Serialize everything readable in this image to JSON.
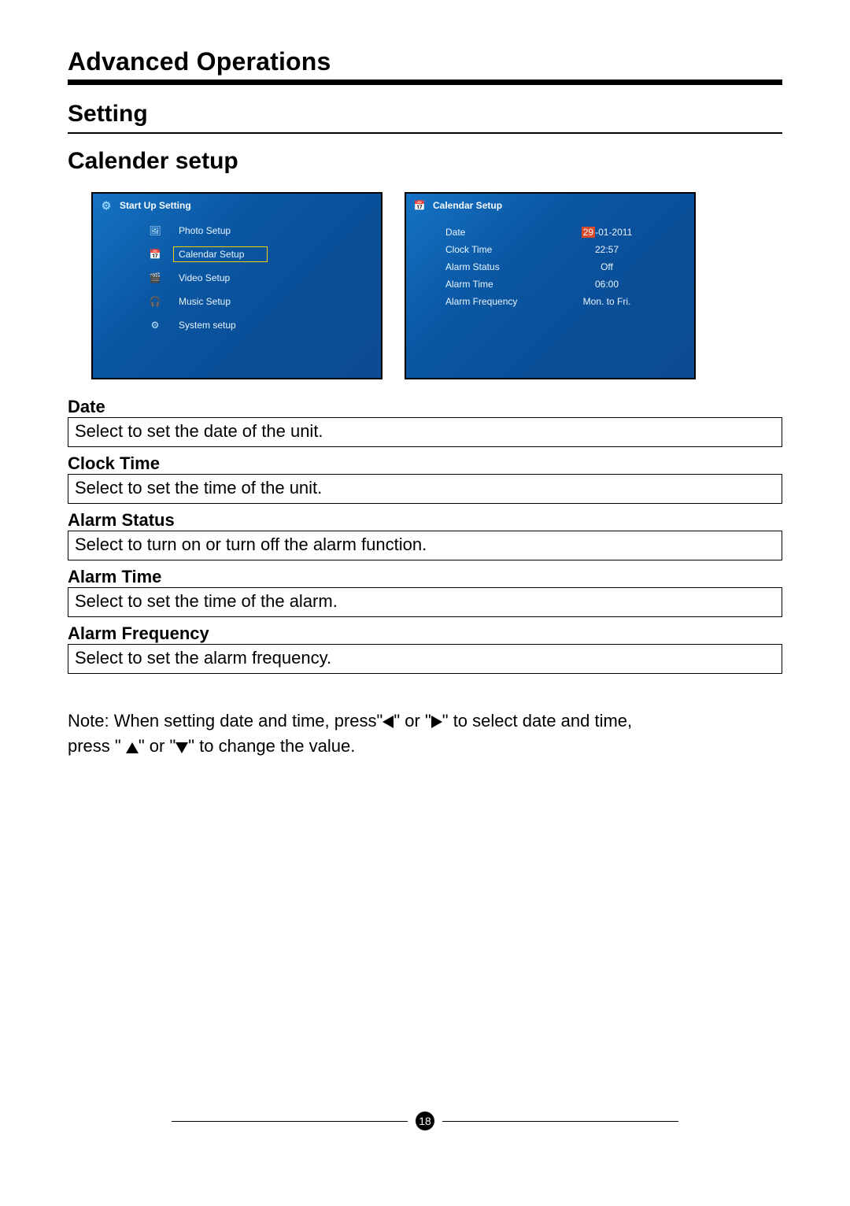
{
  "page": {
    "title": "Advanced Operations",
    "setting_heading": "Setting",
    "calender_heading": "Calender setup",
    "page_number": "18"
  },
  "screen_left": {
    "title": "Start Up Setting",
    "items": [
      {
        "label": "Photo Setup"
      },
      {
        "label": "Calendar Setup"
      },
      {
        "label": "Video Setup"
      },
      {
        "label": "Music Setup"
      },
      {
        "label": "System setup"
      }
    ]
  },
  "screen_right": {
    "title": "Calendar Setup",
    "rows": [
      {
        "label": "Date",
        "value_day": "29",
        "value_rest": "-01-2011"
      },
      {
        "label": "Clock Time",
        "value": "22:57"
      },
      {
        "label": "Alarm Status",
        "value": "Off"
      },
      {
        "label": "Alarm Time",
        "value": "06:00"
      },
      {
        "label": "Alarm Frequency",
        "value": "Mon. to Fri."
      }
    ]
  },
  "definitions": [
    {
      "label": "Date",
      "text": "Select to set the date of the unit."
    },
    {
      "label": "Clock Time",
      "text": "Select to set the time of the unit."
    },
    {
      "label": "Alarm Status",
      "text": "Select to turn on or turn off the alarm function."
    },
    {
      "label": "Alarm Time",
      "text": "Select to set the time of the alarm."
    },
    {
      "label": "Alarm Frequency",
      "text": "Select to set the alarm frequency."
    }
  ],
  "note": {
    "prefix": "Note: When setting date and time, press\"",
    "mid1": "\" or \"",
    "mid2": "\" to select date and time,",
    "line2a": "press \" ",
    "line2b": "\" or \"",
    "line2c": "\" to change the value."
  }
}
